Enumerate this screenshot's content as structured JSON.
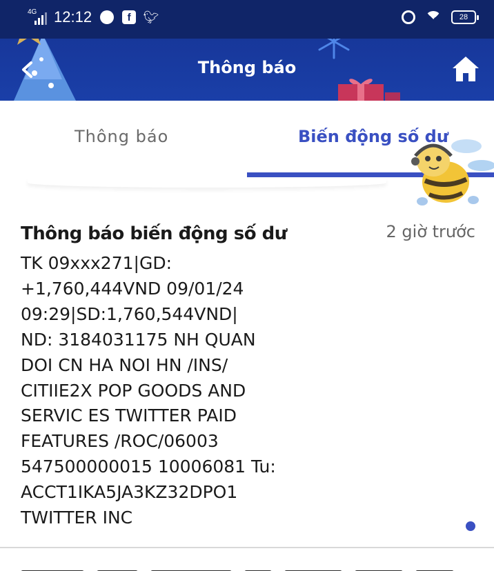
{
  "status_bar": {
    "network": "4G",
    "time": "12:12",
    "battery": "28",
    "icons": [
      "signal-icon",
      "messenger-icon",
      "facebook-icon",
      "twitter-icon",
      "alarm-icon",
      "wifi-icon",
      "battery-icon"
    ]
  },
  "header": {
    "title": "Thông báo",
    "back_icon": "chevron-left-icon",
    "home_icon": "home-icon"
  },
  "tabs": [
    {
      "label": "Thông báo",
      "selected": false
    },
    {
      "label": "Biến động số dư",
      "selected": true
    }
  ],
  "notification": {
    "title": "Thông báo biến động số dư",
    "time": "2 giờ trước",
    "body_lines": [
      "TK 09xxx271|GD:",
      "+1,760,444VND 09/01/24",
      "09:29|SD:1,760,544VND|",
      "ND: 3184031175 NH QUAN",
      "DOI CN HA NOI HN /INS/",
      "CITIIE2X POP GOODS AND",
      "SERVIC ES TWITTER PAID",
      "FEATURES /ROC/06003",
      "547500000015 10006081 Tu:",
      "ACCT1IKA5JA3KZ32DPO1",
      "TWITTER INC"
    ],
    "unread": true
  },
  "colors": {
    "header_bg": "#1a3fa8",
    "status_bg": "#102568",
    "accent": "#3a50c2",
    "text": "#1a1a1a",
    "muted": "#666666"
  }
}
